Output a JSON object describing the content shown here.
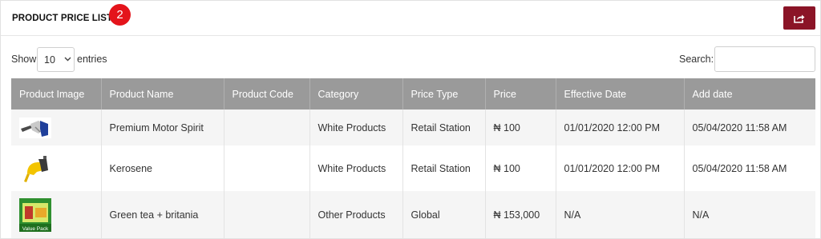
{
  "header": {
    "title": "PRODUCT PRICE LIST",
    "badge": "2",
    "export_icon": "share-export-icon"
  },
  "controls": {
    "show_label": "Show",
    "page_size": "10",
    "entries_label": "entries",
    "search_label": "Search:",
    "search_value": ""
  },
  "table": {
    "columns": [
      "Product Image",
      "Product Name",
      "Product Code",
      "Category",
      "Price Type",
      "Price",
      "Effective Date",
      "Add date"
    ],
    "rows": [
      {
        "image": "fuel-pump-nozzle-blue",
        "name": "Premium Motor Spirit",
        "code": "",
        "category": "White Products",
        "price_type": "Retail Station",
        "price": "₦ 100",
        "effective_date": "01/01/2020 12:00 PM",
        "add_date": "05/04/2020 11:58 AM"
      },
      {
        "image": "fuel-pump-nozzle-yellow",
        "name": "Kerosene",
        "code": "",
        "category": "White Products",
        "price_type": "Retail Station",
        "price": "₦ 100",
        "effective_date": "01/01/2020 12:00 PM",
        "add_date": "05/04/2020 11:58 AM"
      },
      {
        "image": "green-tea-value-pack",
        "name": "Green tea + britania",
        "code": "",
        "category": "Other Products",
        "price_type": "Global",
        "price": "₦ 153,000",
        "effective_date": "N/A",
        "add_date": "N/A"
      }
    ]
  },
  "colors": {
    "export_button": "#8b1427",
    "badge": "#e4141b",
    "table_header": "#9a9a9a"
  },
  "thumb_text": "Value Pack"
}
